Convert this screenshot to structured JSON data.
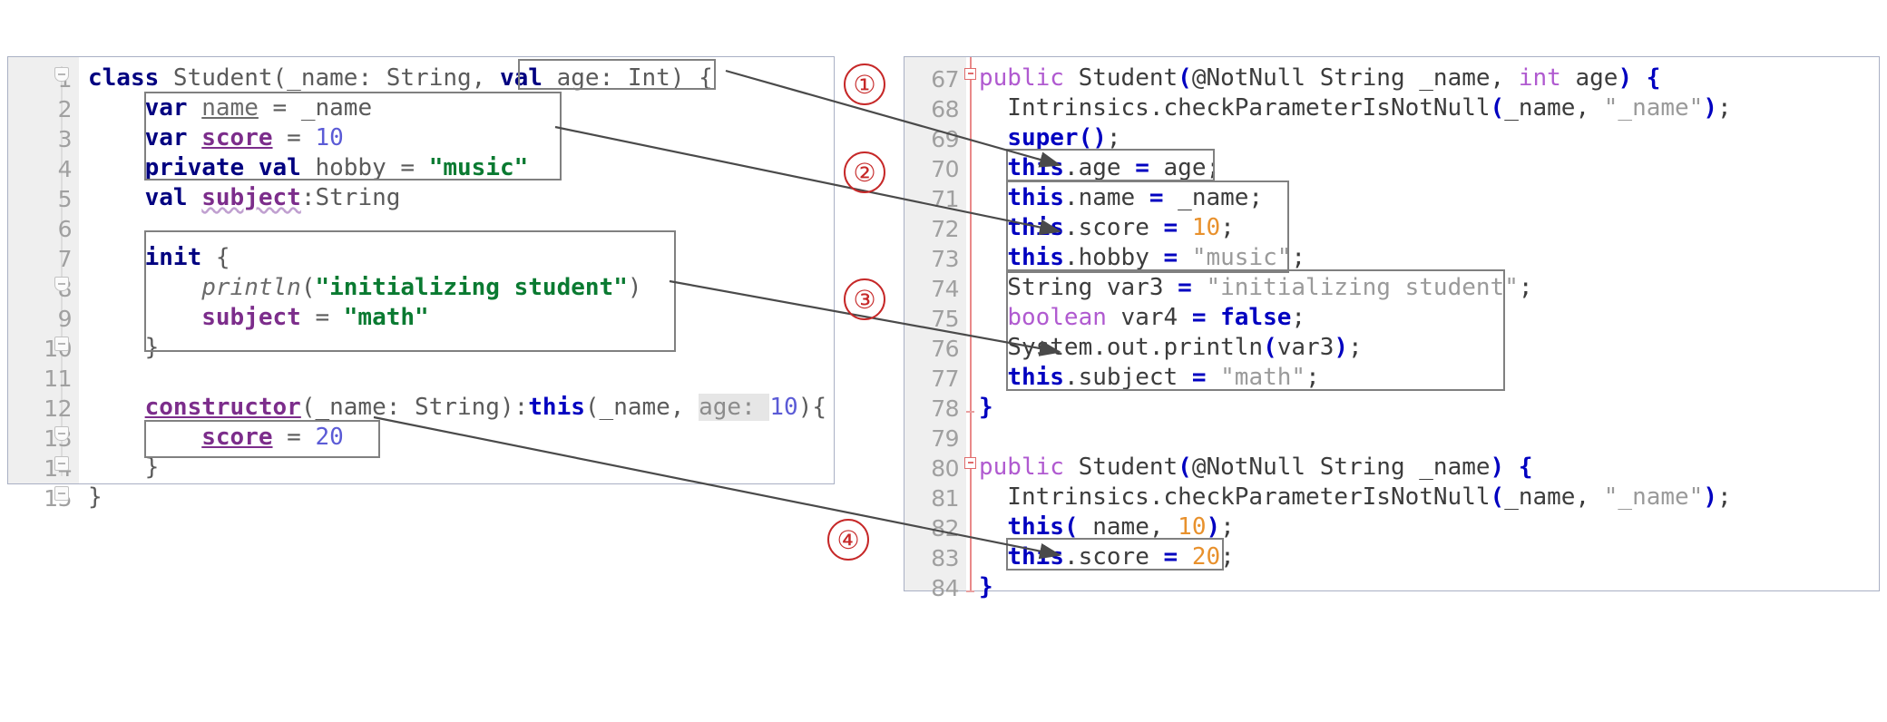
{
  "left_editor": {
    "name": "kotlin-source-editor",
    "language": "Kotlin",
    "first_line": 1,
    "lines": [
      {
        "n": "1",
        "text": "class Student(_name: String, val age: Int) {"
      },
      {
        "n": "2",
        "text": "    var name = _name"
      },
      {
        "n": "3",
        "text": "    var score = 10"
      },
      {
        "n": "4",
        "text": "    private val hobby = \"music\""
      },
      {
        "n": "5",
        "text": "    val subject:String"
      },
      {
        "n": "6",
        "text": ""
      },
      {
        "n": "7",
        "text": "    init {"
      },
      {
        "n": "8",
        "text": "        println(\"initializing student\")"
      },
      {
        "n": "9",
        "text": "        subject = \"math\""
      },
      {
        "n": "10",
        "text": "    }"
      },
      {
        "n": "11",
        "text": ""
      },
      {
        "n": "12",
        "text": "    constructor(_name: String):this(_name, age: 10){"
      },
      {
        "n": "13",
        "text": "        score = 20"
      },
      {
        "n": "14",
        "text": "    }"
      },
      {
        "n": "15",
        "text": "}"
      }
    ]
  },
  "right_editor": {
    "name": "decompiled-java-editor",
    "language": "Java",
    "first_line": 67,
    "lines": [
      {
        "n": "67",
        "text": "public Student(@NotNull String _name, int age) {"
      },
      {
        "n": "68",
        "text": "    Intrinsics.checkParameterIsNotNull(_name, \"_name\");"
      },
      {
        "n": "69",
        "text": "    super();"
      },
      {
        "n": "70",
        "text": "    this.age = age;"
      },
      {
        "n": "71",
        "text": "    this.name = _name;"
      },
      {
        "n": "72",
        "text": "    this.score = 10;"
      },
      {
        "n": "73",
        "text": "    this.hobby = \"music\";"
      },
      {
        "n": "74",
        "text": "    String var3 = \"initializing student\";"
      },
      {
        "n": "75",
        "text": "    boolean var4 = false;"
      },
      {
        "n": "76",
        "text": "    System.out.println(var3);"
      },
      {
        "n": "77",
        "text": "    this.subject = \"math\";"
      },
      {
        "n": "78",
        "text": "  }"
      },
      {
        "n": "79",
        "text": ""
      },
      {
        "n": "80",
        "text": "public Student(@NotNull String _name) {"
      },
      {
        "n": "81",
        "text": "    Intrinsics.checkParameterIsNotNull(_name, \"_name\");"
      },
      {
        "n": "82",
        "text": "    this(_name, 10);"
      },
      {
        "n": "83",
        "text": "    this.score = 20;"
      },
      {
        "n": "84",
        "text": "  }"
      }
    ]
  },
  "annotations": {
    "markers": [
      {
        "id": "1",
        "label": "①",
        "from": "kotlin val age: Int",
        "to": "java line 70 this.age = age;"
      },
      {
        "id": "2",
        "label": "②",
        "from": "kotlin property block lines 2-4",
        "to": "java lines 71-73 field assignments"
      },
      {
        "id": "3",
        "label": "③",
        "from": "kotlin init block lines 7-10",
        "to": "java lines 74-77 init body"
      },
      {
        "id": "4",
        "label": "④",
        "from": "kotlin secondary constructor score = 20",
        "to": "java line 83 this.score = 20;"
      }
    ],
    "highlight_boxes": [
      {
        "name": "kotlin-val-age-box",
        "target": "val age: Int"
      },
      {
        "name": "kotlin-properties-box",
        "target": "var name / var score / private val hobby"
      },
      {
        "name": "kotlin-init-box",
        "target": "init { println(...) subject = \"math\" }"
      },
      {
        "name": "kotlin-score-20-box",
        "target": "score = 20"
      },
      {
        "name": "java-this-age-box",
        "target": "this.age = age;"
      },
      {
        "name": "java-field-assign-box",
        "target": "this.name/this.score/this.hobby"
      },
      {
        "name": "java-init-body-box",
        "target": "String var3 ... this.subject = \"math\";"
      },
      {
        "name": "java-this-score-20-box",
        "target": "this.score = 20;"
      }
    ]
  },
  "colors": {
    "keyword": "#000080",
    "string_kotlin": "#0a7a31",
    "string_java": "#9a9a9a",
    "number_kotlin": "#5b5bd6",
    "number_java": "#e8912d",
    "field": "#7c2d8b",
    "modifier": "#b05ad0",
    "marker_red": "#c62828",
    "box_border": "#808080",
    "gutter_bg": "#efefef",
    "panel_border": "#a9b0c4"
  }
}
